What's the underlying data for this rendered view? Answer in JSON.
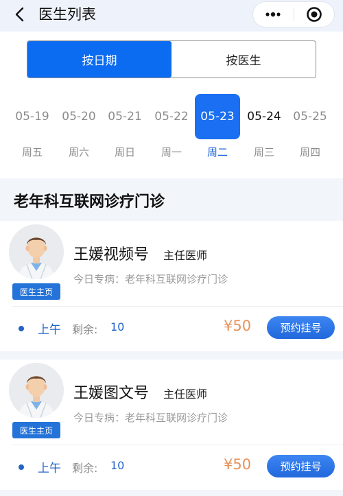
{
  "header": {
    "title": "医生列表"
  },
  "mode_tabs": [
    {
      "label": "按日期",
      "active": true
    },
    {
      "label": "按医生",
      "active": false
    }
  ],
  "dates": [
    {
      "date": "05-19",
      "weekday": "周五"
    },
    {
      "date": "05-20",
      "weekday": "周六"
    },
    {
      "date": "05-21",
      "weekday": "周日"
    },
    {
      "date": "05-22",
      "weekday": "周一"
    },
    {
      "date": "05-23",
      "weekday": "周二",
      "selected": true
    },
    {
      "date": "05-24",
      "weekday": "周三"
    },
    {
      "date": "05-25",
      "weekday": "周四"
    }
  ],
  "section": {
    "title": "老年科互联网诊疗门诊"
  },
  "doctors": [
    {
      "name": "王媛视频号",
      "rank": "主任医师",
      "specialty": "今日专病：老年科互联网诊疗门诊",
      "home_label": "医生主页",
      "slot_period": "上午",
      "remain_label": "剩余:",
      "remain_value": "10",
      "price": "¥50",
      "book_label": "预约挂号"
    },
    {
      "name": "王媛图文号",
      "rank": "主任医师",
      "specialty": "今日专病：老年科互联网诊疗门诊",
      "home_label": "医生主页",
      "slot_period": "上午",
      "remain_label": "剩余:",
      "remain_value": "10",
      "price": "¥50",
      "book_label": "预约挂号"
    }
  ],
  "colors": {
    "accent": "#0c6cf1",
    "price": "#e8925a",
    "link_blue": "#2363c8"
  },
  "icons": [
    "back-arrow-icon",
    "more-dots-icon",
    "target-icon",
    "doctor-avatar-icon"
  ]
}
